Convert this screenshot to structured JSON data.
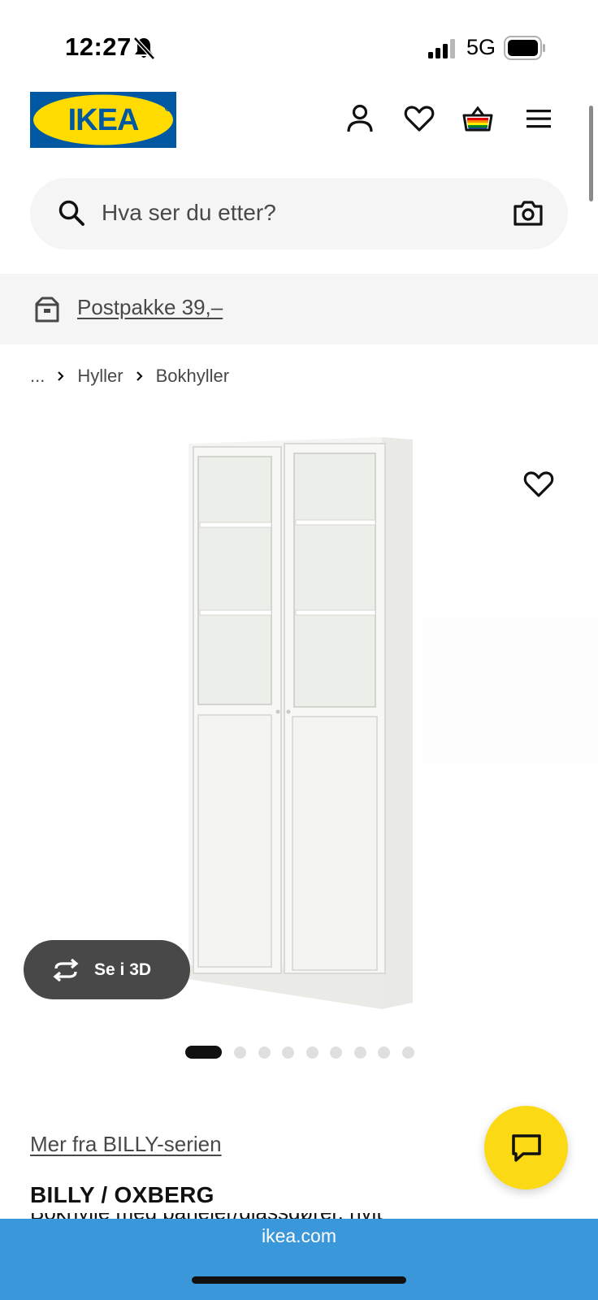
{
  "status_bar": {
    "time": "12:27",
    "network": "5G",
    "icons": [
      "bell-slash-icon",
      "signal-icon",
      "battery-icon"
    ]
  },
  "header": {
    "logo_text": "IKEA",
    "icons": [
      "account-icon",
      "heart-icon",
      "basket-icon",
      "menu-icon"
    ],
    "brand_colors": {
      "blue": "#0058a3",
      "yellow": "#ffdb00"
    }
  },
  "search": {
    "placeholder": "Hva ser du etter?",
    "icons": [
      "search-icon",
      "camera-icon"
    ]
  },
  "delivery_banner": {
    "icon": "box-icon",
    "text": "Postpakke 39,–"
  },
  "breadcrumb": {
    "items": [
      "...",
      "Hyller",
      "Bokhyller"
    ]
  },
  "product": {
    "view_3d_label": "Se i 3D",
    "carousel": {
      "total": 9,
      "active_index": 0
    },
    "series_link": "Mer fra BILLY-serien",
    "name": "BILLY / OXBERG",
    "description": "Bokhylle med paneler/glassdører, hvit"
  },
  "chat": {
    "icon": "chat-icon",
    "color": "#fbd914"
  },
  "browser": {
    "url": "ikea.com",
    "bar_color": "#3a97d9"
  }
}
